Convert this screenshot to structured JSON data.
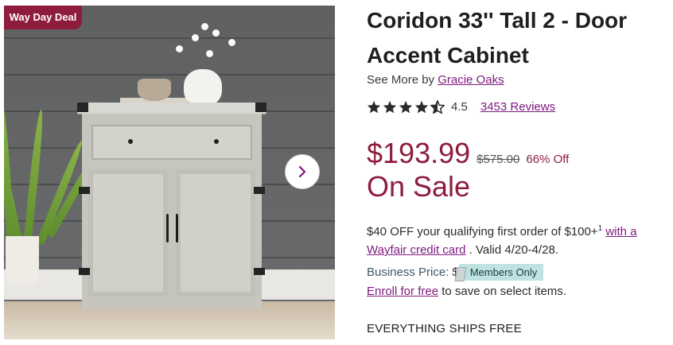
{
  "badge": {
    "label": "Way Day Deal",
    "color": "#8e1d3d"
  },
  "gallery": {
    "next_icon": "chevron-right-icon"
  },
  "product": {
    "title": "Coridon 33'' Tall 2 - Door Accent Cabinet",
    "see_more_prefix": "See More by",
    "brand": "Gracie Oaks"
  },
  "rating": {
    "stars": 4.5,
    "value": "4.5",
    "reviews": "3453 Reviews"
  },
  "price": {
    "current": "$193.99",
    "original": "$575.00",
    "discount": "66% Off",
    "sale_label": "On Sale",
    "accent": "#8e1d3d"
  },
  "promo": {
    "text": "$40 OFF your qualifying first order of $100+",
    "footnote": "1",
    "link": "with a Wayfair credit card",
    "validity": ". Valid 4/20-4/28."
  },
  "business": {
    "label": "Business Price:",
    "dollar": "$",
    "members_badge": "Members Only"
  },
  "enroll": {
    "link": "Enroll for free",
    "suffix": "to save on select items."
  },
  "shipping": {
    "label": "EVERYTHING SHIPS FREE"
  },
  "link_color": "#7f187f"
}
